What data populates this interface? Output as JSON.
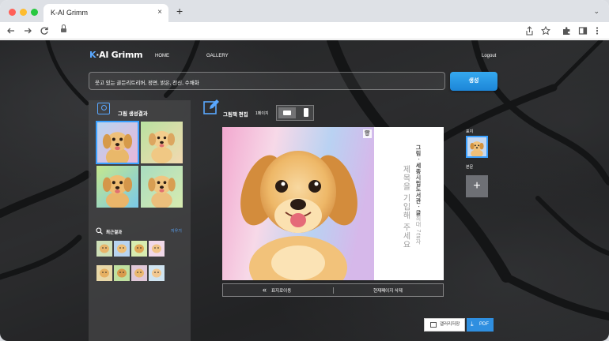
{
  "browser": {
    "tab_title": "K-AI Grimm",
    "tab_close": "×",
    "new_tab": "+",
    "tab_menu": "⌄"
  },
  "header": {
    "logo_k": "K",
    "logo_text": "·AI Grimm",
    "nav_home": "HOME",
    "nav_gallery": "GALLERY",
    "nav_logout": "Logout"
  },
  "prompt": {
    "value": "웃고 있는 골든리트리버, 정면, 밝은, 전신, 수채화",
    "generate_label": "생성"
  },
  "results": {
    "title": "그림 생성결과",
    "recent_title": "최근결과",
    "recent_clear": "지우기"
  },
  "editor": {
    "title": "그림책 편집",
    "page_count": "1페이지",
    "cover_title_placeholder": "제목을 기입해 주세요",
    "author_bold": "그림 · 세종시립도서관 · 글",
    "author_light": "최대 7글자",
    "trash_icon": "🗑",
    "to_cover_label": "표지로이동",
    "delete_page_label": "현재페이지 삭제",
    "cover_label": "표지",
    "body_label": "본문",
    "add_page": "+"
  },
  "actions": {
    "save_gallery": "갤러리저장",
    "pdf": "PDF"
  },
  "colors": {
    "accent": "#2f8fe0",
    "selected_outline": "#3aa0ff"
  }
}
